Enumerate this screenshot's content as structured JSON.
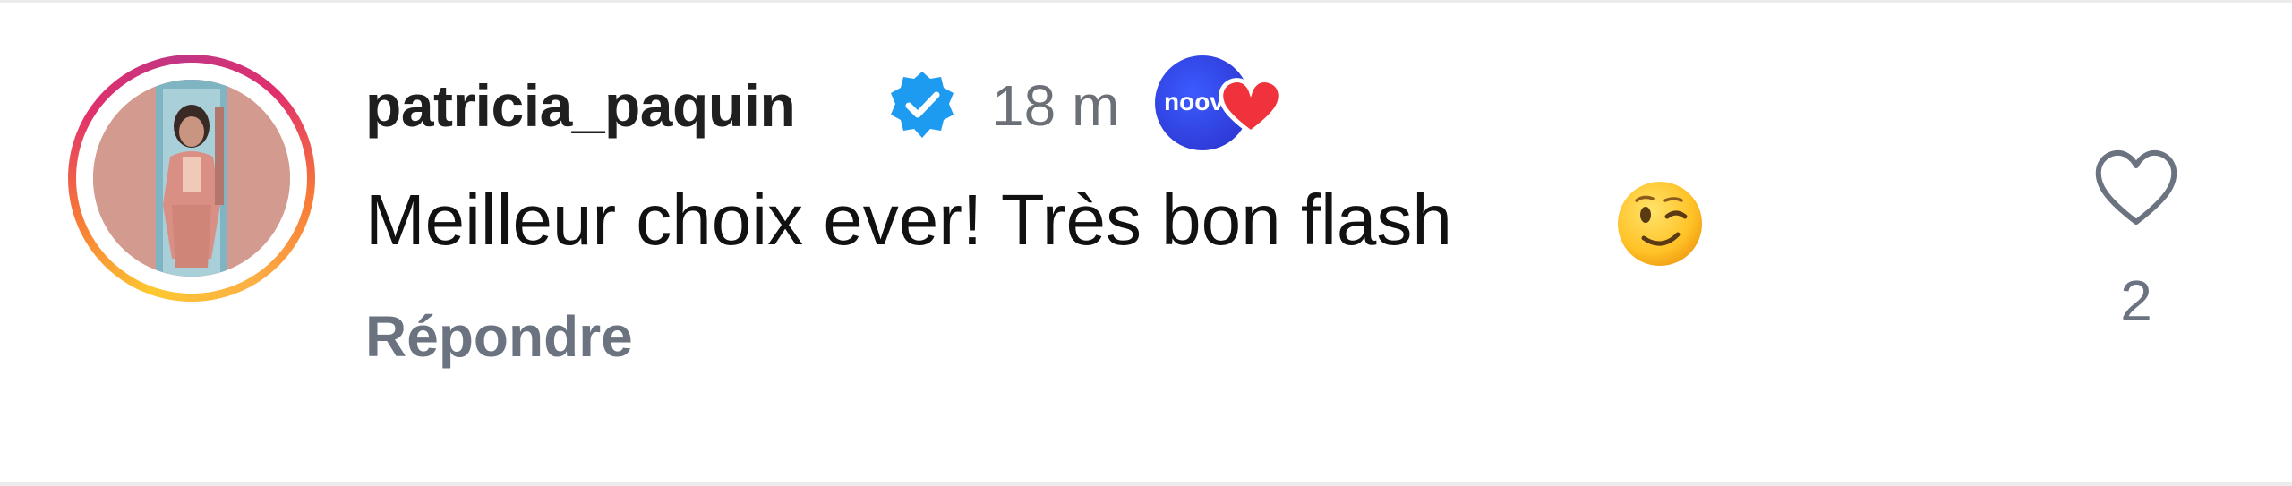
{
  "comment": {
    "username": "patricia_paquin",
    "verified_icon": "verified-badge-icon",
    "time": "18 m",
    "badge": {
      "text": "noov",
      "icon": "heart-icon",
      "circle_color": "#2f3ce0",
      "heart_color": "#f0323c"
    },
    "text": "Meilleur choix ever! Très bon flash",
    "emoji": "winking-face-emoji",
    "reply_label": "Répondre",
    "like": {
      "icon": "heart-outline-icon",
      "count": "2"
    }
  },
  "colors": {
    "verified_blue": "#1d9bf0",
    "secondary_text": "#6b7280",
    "primary_text": "#111111"
  }
}
